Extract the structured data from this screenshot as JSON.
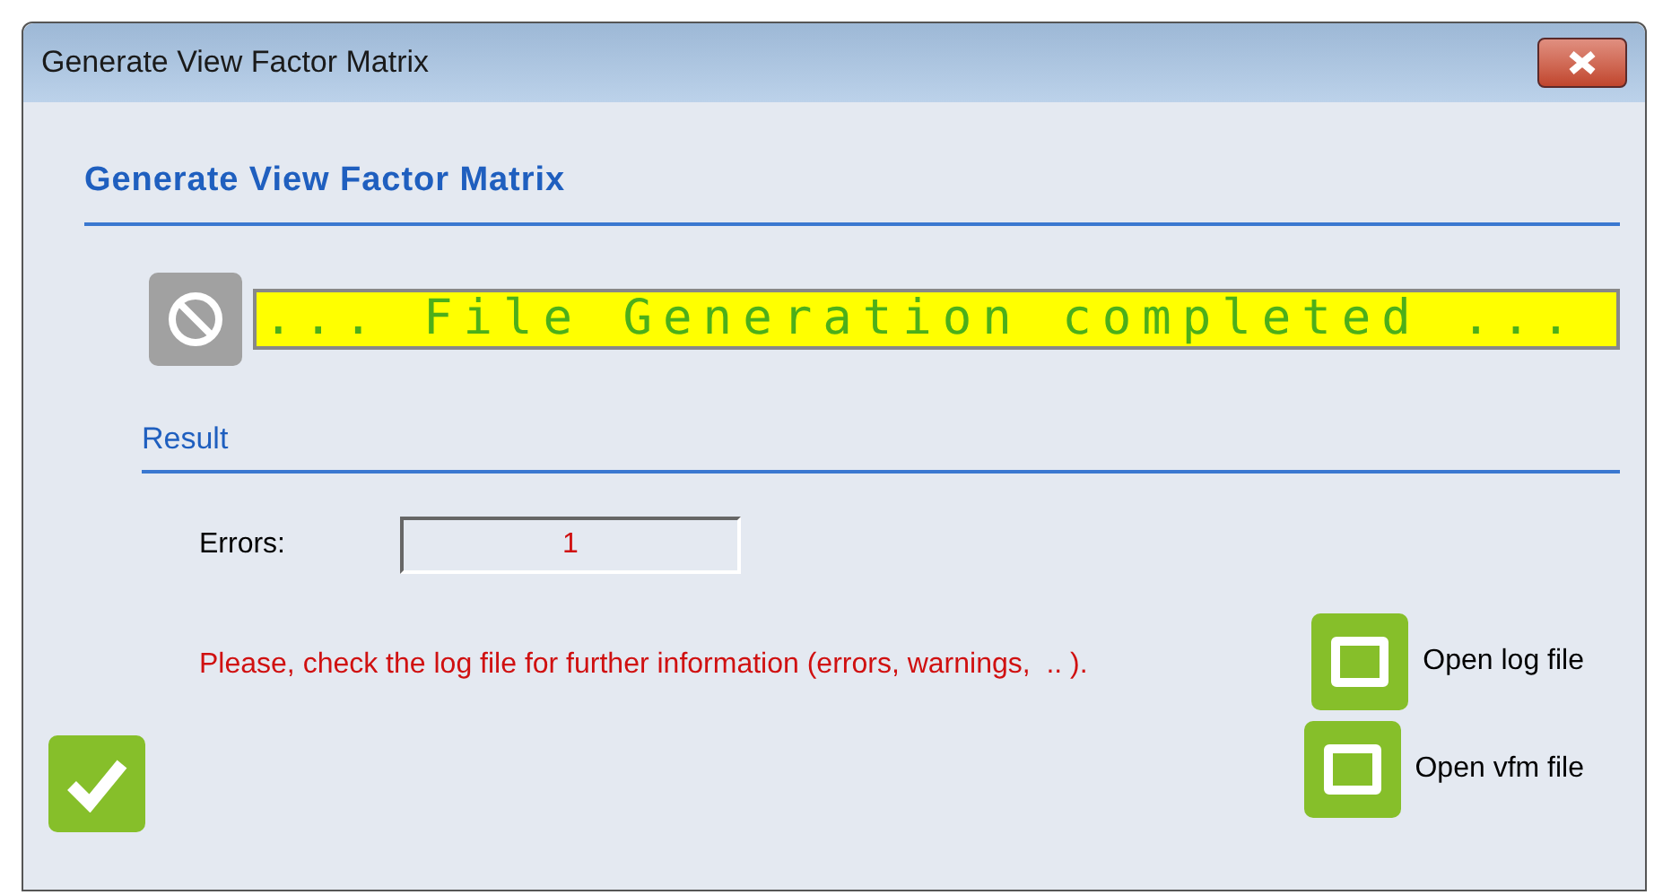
{
  "window": {
    "title": "Generate View Factor Matrix"
  },
  "header": {
    "title": "Generate View Factor Matrix"
  },
  "status": {
    "message": "... File Generation completed ..."
  },
  "result": {
    "title": "Result",
    "errors_label": "Errors:",
    "errors_value": "1"
  },
  "notice": "Please, check the log file for further information (errors, warnings,  .. ).",
  "actions": [
    {
      "label": "Open log file"
    },
    {
      "label": "Open vfm file"
    }
  ]
}
